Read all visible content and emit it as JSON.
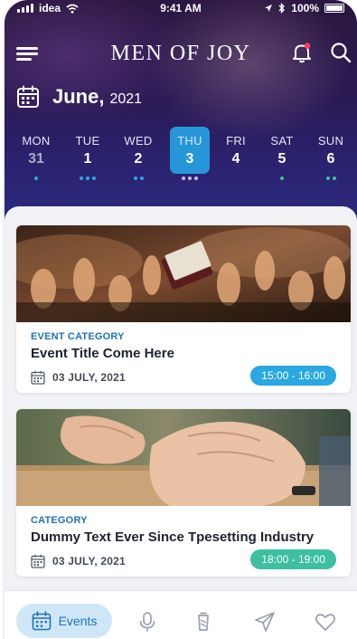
{
  "status": {
    "carrier": "idea",
    "time": "9:41 AM",
    "battery": "100%"
  },
  "app": {
    "title": "MEN OF JOY"
  },
  "calendar": {
    "month": "June,",
    "year": "2021",
    "days": [
      {
        "label": "MON",
        "num": "31",
        "dots": 1,
        "dot_color": "#2aa8e0",
        "dim": true
      },
      {
        "label": "TUE",
        "num": "1",
        "dots": 3,
        "dot_color": "#2aa8e0"
      },
      {
        "label": "WED",
        "num": "2",
        "dots": 2,
        "dot_color": "#2aa8e0"
      },
      {
        "label": "THU",
        "num": "3",
        "dots": 3,
        "dot_color": "#c9b8e8",
        "selected": true
      },
      {
        "label": "FRI",
        "num": "4",
        "dots": 0
      },
      {
        "label": "SAT",
        "num": "5",
        "dots": 1,
        "dot_color": "#3cc0a0"
      },
      {
        "label": "SUN",
        "num": "6",
        "dots": 2,
        "dot_color": "#3cc0a0"
      }
    ]
  },
  "events": [
    {
      "category": "EVENT CATEGORY",
      "title": "Event Title Come Here",
      "date": "03 JULY, 2021",
      "time": "15:00 - 16:00",
      "pill_color": "#2aa8e0"
    },
    {
      "category": "CATEGORY",
      "title": "Dummy Text Ever Since Tpesetting Industry",
      "date": "03 JULY, 2021",
      "time": "18:00 - 19:00",
      "pill_color": "#3cc0a0"
    }
  ],
  "tabs": {
    "events_label": "Events"
  },
  "colors": {
    "accent": "#2596d8",
    "header_dark": "#2a1640",
    "active_tab_bg": "#cfe6f7"
  }
}
